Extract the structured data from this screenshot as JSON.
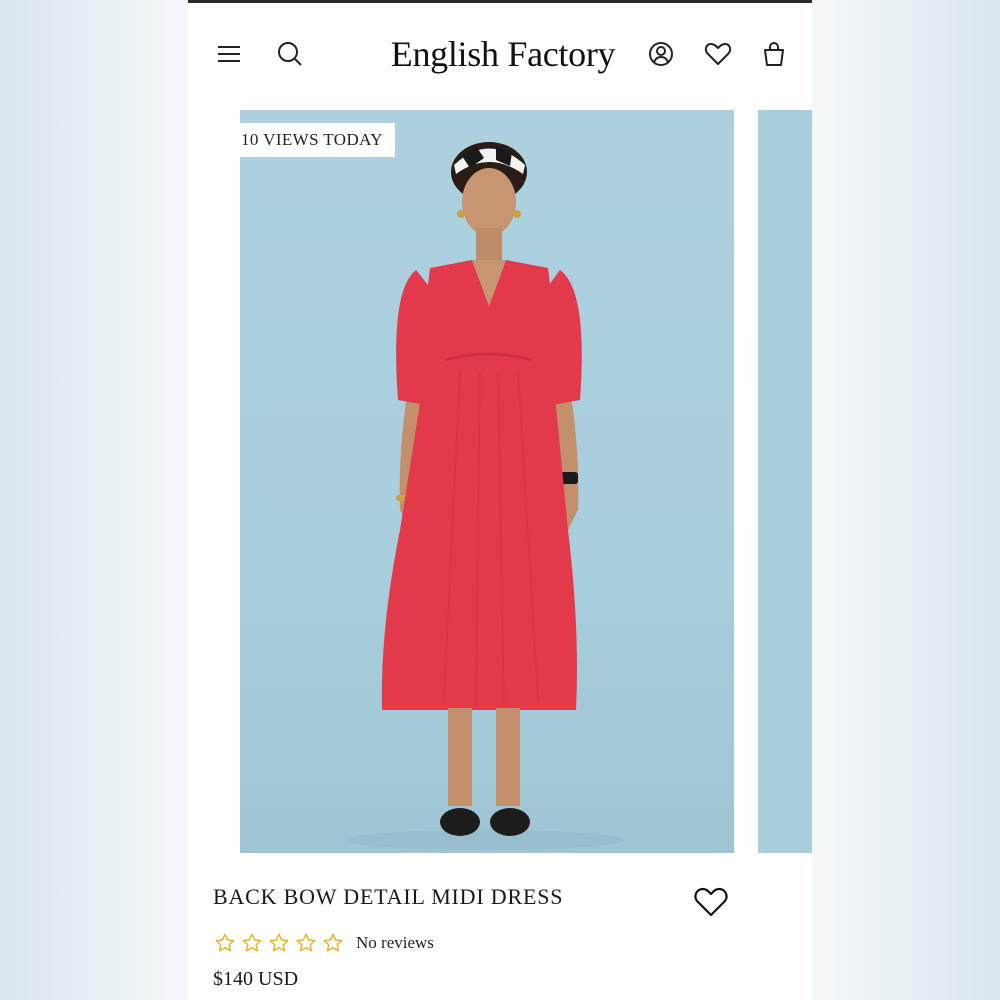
{
  "header": {
    "brand": "English Factory",
    "icons": [
      "menu-icon",
      "search-icon",
      "account-icon",
      "heart-icon",
      "bag-icon"
    ]
  },
  "product": {
    "views_badge": "10 VIEWS TODAY",
    "title": "BACK BOW DETAIL MIDI DRESS",
    "rating": {
      "stars_filled": 0,
      "stars_total": 5,
      "reviews_label": "No reviews"
    },
    "price": "$140 USD"
  },
  "colors": {
    "photo_background": "#acd0de",
    "dress": "#e03a4a",
    "star_outline": "#e6b422",
    "text": "#1a1a1a"
  }
}
